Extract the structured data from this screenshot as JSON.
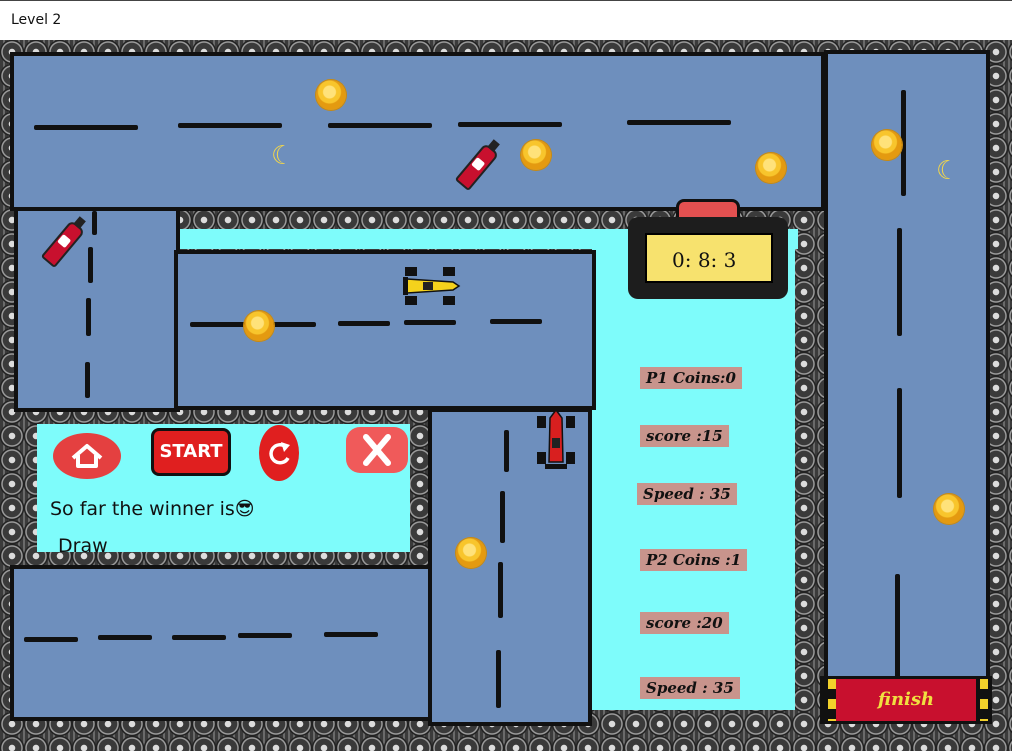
{
  "window": {
    "title": "Level 2"
  },
  "timer": {
    "display": "0: 8: 3"
  },
  "player1": {
    "coins": "P1 Coins:0",
    "score": "score :15",
    "speed": "Speed : 35"
  },
  "player2": {
    "coins": "P2 Coins :1",
    "score": "score :20",
    "speed": "Speed : 35"
  },
  "menu": {
    "start_label": "START",
    "winner_label": "So far the winner is",
    "winner_value": "Draw",
    "emoji": "😎"
  },
  "finish": {
    "label": "finish"
  },
  "icons": {
    "home": "home-icon",
    "restart": "restart-icon",
    "close": "close-icon",
    "coin": "coin-icon",
    "banana": "banana-peel-icon",
    "extinguisher": "fire-extinguisher-icon",
    "car_yellow": "yellow-race-car",
    "car_red": "red-race-car"
  },
  "colors": {
    "road": "#6e8fbd",
    "panel": "#7efcfb",
    "stat_bg": "#c8948c",
    "accent_red": "#e01f1f",
    "timer_face": "#f7e26e"
  }
}
